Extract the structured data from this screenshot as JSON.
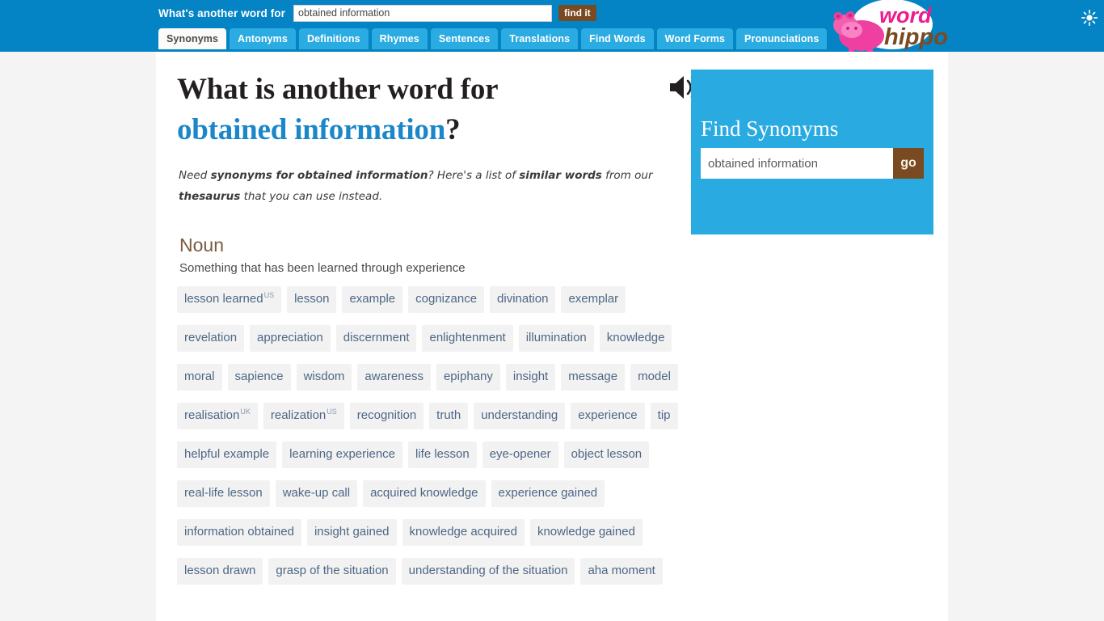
{
  "header": {
    "label": "What's another word for",
    "search_value": "obtained information",
    "search_placeholder": "",
    "find_button": "find it",
    "logo_word": "word",
    "logo_hippo": "hippo",
    "theme_icon": "sun-icon",
    "colors": {
      "header_bg": "#0484c4",
      "tab_bg": "#29ABE2",
      "tab_active_bg": "#fcfbf9",
      "brown": "#7a4a22",
      "accent_blue": "#1b87c9"
    },
    "tabs": [
      {
        "label": "Synonyms",
        "active": true
      },
      {
        "label": "Antonyms",
        "active": false
      },
      {
        "label": "Definitions",
        "active": false
      },
      {
        "label": "Rhymes",
        "active": false
      },
      {
        "label": "Sentences",
        "active": false
      },
      {
        "label": "Translations",
        "active": false
      },
      {
        "label": "Find Words",
        "active": false
      },
      {
        "label": "Word Forms",
        "active": false
      },
      {
        "label": "Pronunciations",
        "active": false
      }
    ]
  },
  "main": {
    "title_line1": "What is another word for",
    "title_phrase": "obtained information",
    "title_qmark": "?",
    "speaker_icon": "speaker-icon",
    "lead_html": "Need <b>synonyms for obtained information</b>? Here's a list of <b>similar words</b> from our <b>thesaurus</b> that you can use instead.",
    "pos_heading": "Noun",
    "pos_definition": "Something that has been learned through experience",
    "synonyms": [
      {
        "word": "lesson learned",
        "sup": "US"
      },
      {
        "word": "lesson",
        "sup": ""
      },
      {
        "word": "example",
        "sup": ""
      },
      {
        "word": "cognizance",
        "sup": ""
      },
      {
        "word": "divination",
        "sup": ""
      },
      {
        "word": "exemplar",
        "sup": ""
      },
      {
        "word": "revelation",
        "sup": ""
      },
      {
        "word": "appreciation",
        "sup": ""
      },
      {
        "word": "discernment",
        "sup": ""
      },
      {
        "word": "enlightenment",
        "sup": ""
      },
      {
        "word": "illumination",
        "sup": ""
      },
      {
        "word": "knowledge",
        "sup": ""
      },
      {
        "word": "moral",
        "sup": ""
      },
      {
        "word": "sapience",
        "sup": ""
      },
      {
        "word": "wisdom",
        "sup": ""
      },
      {
        "word": "awareness",
        "sup": ""
      },
      {
        "word": "epiphany",
        "sup": ""
      },
      {
        "word": "insight",
        "sup": ""
      },
      {
        "word": "message",
        "sup": ""
      },
      {
        "word": "model",
        "sup": ""
      },
      {
        "word": "realisation",
        "sup": "UK"
      },
      {
        "word": "realization",
        "sup": "US"
      },
      {
        "word": "recognition",
        "sup": ""
      },
      {
        "word": "truth",
        "sup": ""
      },
      {
        "word": "understanding",
        "sup": ""
      },
      {
        "word": "experience",
        "sup": ""
      },
      {
        "word": "tip",
        "sup": ""
      },
      {
        "word": "helpful example",
        "sup": ""
      },
      {
        "word": "learning experience",
        "sup": ""
      },
      {
        "word": "life lesson",
        "sup": ""
      },
      {
        "word": "eye-opener",
        "sup": ""
      },
      {
        "word": "object lesson",
        "sup": ""
      },
      {
        "word": "real-life lesson",
        "sup": ""
      },
      {
        "word": "wake-up call",
        "sup": ""
      },
      {
        "word": "acquired knowledge",
        "sup": ""
      },
      {
        "word": "experience gained",
        "sup": ""
      },
      {
        "word": "information obtained",
        "sup": ""
      },
      {
        "word": "insight gained",
        "sup": ""
      },
      {
        "word": "knowledge acquired",
        "sup": ""
      },
      {
        "word": "knowledge gained",
        "sup": ""
      },
      {
        "word": "lesson drawn",
        "sup": ""
      },
      {
        "word": "grasp of the situation",
        "sup": ""
      },
      {
        "word": "understanding of the situation",
        "sup": ""
      },
      {
        "word": "aha moment",
        "sup": ""
      }
    ]
  },
  "sidebar": {
    "title": "Find Synonyms",
    "search_value": "obtained information",
    "search_placeholder": "",
    "go_button": "go"
  }
}
